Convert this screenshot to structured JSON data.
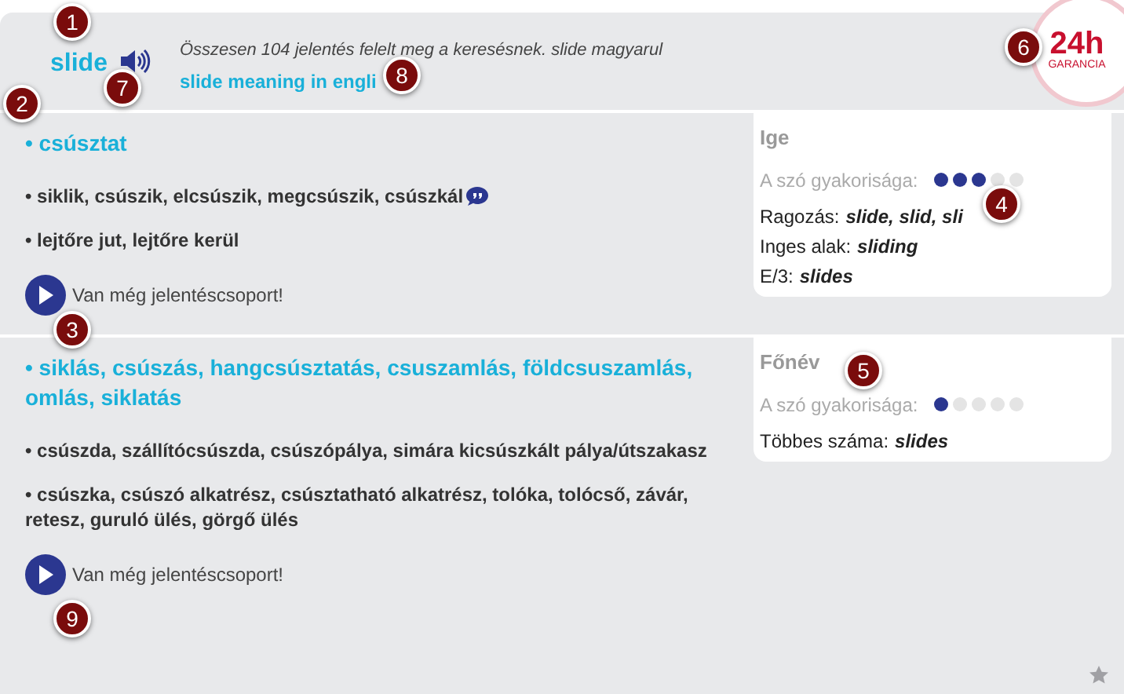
{
  "header": {
    "word": "slide",
    "summary": "Összesen 104 jelentés felelt meg a keresésnek. slide magyarul",
    "link": "slide meaning in engli"
  },
  "badge": {
    "big": "24h",
    "small": "GARANCIA"
  },
  "sections": [
    {
      "meanings": [
        {
          "kind": "head",
          "text": "• csúsztat"
        },
        {
          "kind": "plain",
          "text": "• siklik, csúszik, elcsúszik, megcsúszik, csúszkál",
          "quote": true
        },
        {
          "kind": "plain",
          "text": "• lejtőre jut, lejtőre kerül"
        }
      ],
      "more": "Van még jelentéscsoport!",
      "card": {
        "pos": "Ige",
        "freq_label": "A szó gyakorisága:",
        "stars": 3,
        "lines": [
          {
            "label": "Ragozás:",
            "value": "slide, slid, sli"
          },
          {
            "label": "Inges alak:",
            "value": "sliding"
          },
          {
            "label": "E/3:",
            "value": "slides"
          }
        ]
      }
    },
    {
      "meanings": [
        {
          "kind": "head",
          "text": "• siklás, csúszás, hangcsúsztatás, csuszamlás, földcsuszamlás, omlás, siklatás"
        },
        {
          "kind": "plain",
          "text": "• csúszda, szállítócsúszda, csúszópálya, simára kicsúszkált pálya/útszakasz"
        },
        {
          "kind": "plain",
          "text": "• csúszka, csúszó alkatrész, csúsztatható alkatrész, tolóka, tolócső, závár, retesz, guruló ülés, görgő ülés"
        }
      ],
      "more": "Van még jelentéscsoport!",
      "card": {
        "pos": "Főnév",
        "freq_label": "A szó gyakorisága:",
        "stars": 1,
        "lines": [
          {
            "label": "Többes száma:",
            "value": "slides"
          }
        ]
      }
    }
  ],
  "markers": [
    "1",
    "2",
    "3",
    "4",
    "5",
    "6",
    "7",
    "8",
    "9"
  ]
}
